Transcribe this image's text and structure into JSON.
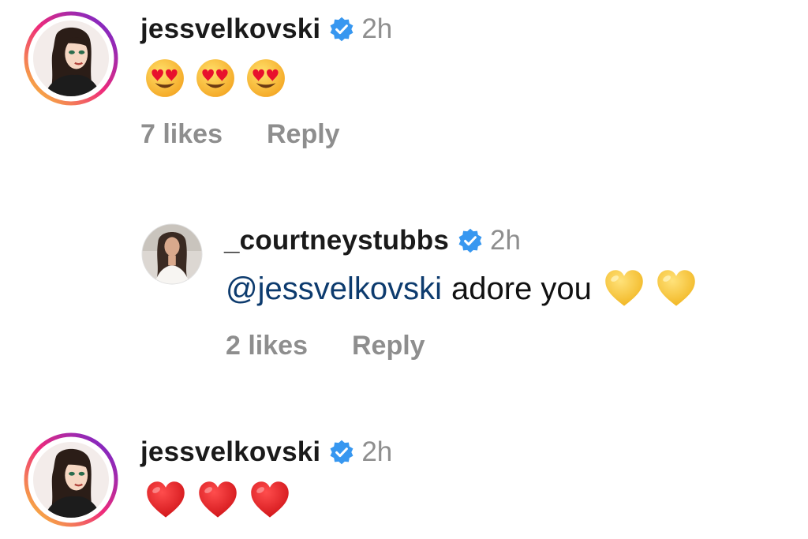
{
  "comments": [
    {
      "username": "jessvelkovski",
      "verified": true,
      "time": "2h",
      "emojis": [
        "heart-eyes",
        "heart-eyes",
        "heart-eyes"
      ],
      "likes": "7 likes",
      "reply_label": "Reply"
    },
    {
      "username": "_courtneystubbs",
      "verified": true,
      "time": "2h",
      "mention": "@jessvelkovski",
      "text": "adore you",
      "emojis": [
        "yellow-heart",
        "yellow-heart"
      ],
      "likes": "2 likes",
      "reply_label": "Reply"
    },
    {
      "username": "jessvelkovski",
      "verified": true,
      "time": "2h",
      "emojis": [
        "red-heart",
        "red-heart",
        "red-heart"
      ]
    }
  ],
  "colors": {
    "verified_badge": "#3797f0",
    "mention": "#0d3b6e",
    "muted": "#8e8e8e",
    "story_ring_start": "#f9ce34",
    "story_ring_mid": "#ee2a7b",
    "story_ring_end": "#6228d7"
  }
}
